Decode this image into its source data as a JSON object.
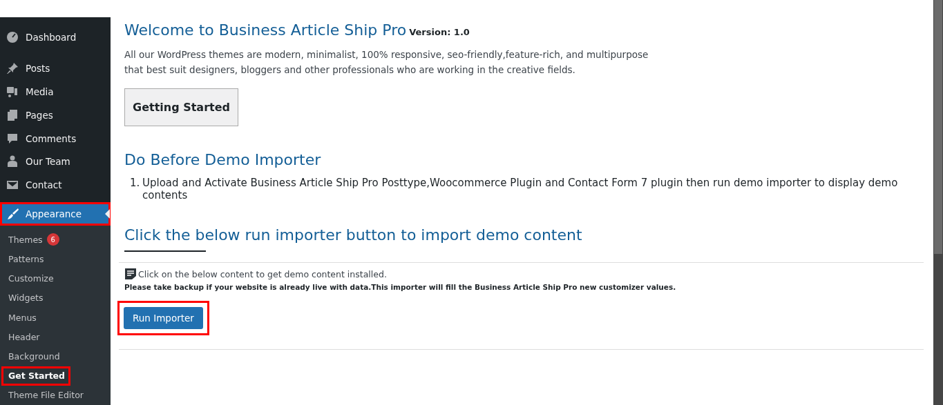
{
  "sidebar": {
    "items": [
      {
        "label": "Dashboard",
        "kind": "dashboard",
        "selected": false,
        "highlighted": false
      },
      {
        "label": "Posts",
        "kind": "pin",
        "selected": false,
        "highlighted": false
      },
      {
        "label": "Media",
        "kind": "media",
        "selected": false,
        "highlighted": false
      },
      {
        "label": "Pages",
        "kind": "pages",
        "selected": false,
        "highlighted": false
      },
      {
        "label": "Comments",
        "kind": "comment",
        "selected": false,
        "highlighted": false
      },
      {
        "label": "Our Team",
        "kind": "person",
        "selected": false,
        "highlighted": false
      },
      {
        "label": "Contact",
        "kind": "mail",
        "selected": false,
        "highlighted": false
      },
      {
        "label": "Appearance",
        "kind": "brush",
        "selected": true,
        "highlighted": true
      }
    ],
    "submenu": [
      {
        "label": "Themes",
        "badge": "6",
        "selected": false,
        "highlighted": false
      },
      {
        "label": "Patterns",
        "selected": false,
        "highlighted": false
      },
      {
        "label": "Customize",
        "selected": false,
        "highlighted": false
      },
      {
        "label": "Widgets",
        "selected": false,
        "highlighted": false
      },
      {
        "label": "Menus",
        "selected": false,
        "highlighted": false
      },
      {
        "label": "Header",
        "selected": false,
        "highlighted": false
      },
      {
        "label": "Background",
        "selected": false,
        "highlighted": false
      },
      {
        "label": "Get Started",
        "selected": true,
        "highlighted": true
      },
      {
        "label": "Theme File Editor",
        "selected": false,
        "highlighted": false
      }
    ]
  },
  "main": {
    "title": "Welcome to Business Article Ship Pro",
    "version": "Version: 1.0",
    "intro": "All our WordPress themes are modern, minimalist, 100% responsive, seo-friendly,feature-rich, and multipurpose that best suit designers, bloggers and other professionals who are working in the creative fields.",
    "getting_started": "Getting Started",
    "before_heading": "Do Before Demo Importer",
    "steps": [
      {
        "marker": "1.",
        "text": "Upload and Activate Business Article Ship Pro Posttype,Woocommerce Plugin and Contact Form 7 plugin then run demo importer to display demo contents"
      }
    ],
    "import_heading": "Click the below run importer button to import demo content",
    "note": "Click on the below content to get demo content installed.",
    "warning": "Please take backup if your website is already live with data.This importer will fill the Business Article Ship Pro new customizer values.",
    "run_button": {
      "label": "Run Importer",
      "highlighted": true
    }
  }
}
